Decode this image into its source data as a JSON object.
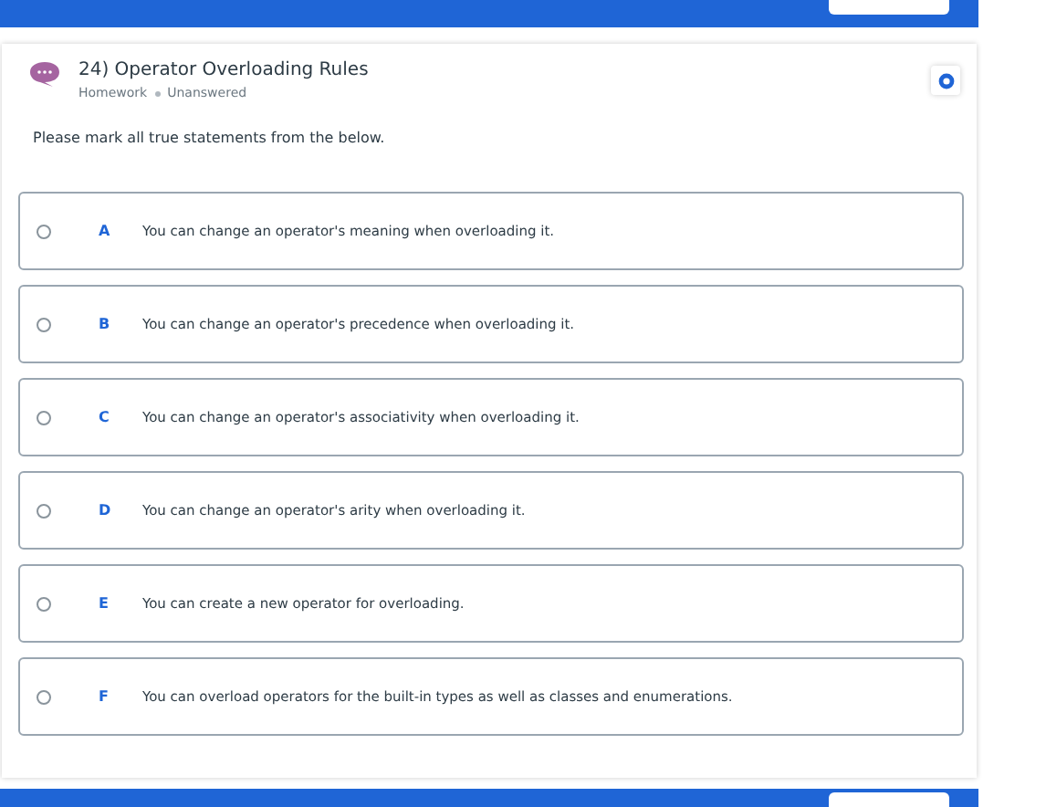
{
  "question": {
    "title": "24) Operator Overloading Rules",
    "type": "Homework",
    "status": "Unanswered",
    "prompt": "Please mark all true statements from the below."
  },
  "options": [
    {
      "letter": "A",
      "text": "You can change an operator's meaning when overloading it.",
      "selected": false
    },
    {
      "letter": "B",
      "text": "You can change an operator's precedence when overloading it.",
      "selected": false
    },
    {
      "letter": "C",
      "text": "You can change an operator's associativity when overloading it.",
      "selected": false
    },
    {
      "letter": "D",
      "text": "You can change an operator's arity when overloading it.",
      "selected": false
    },
    {
      "letter": "E",
      "text": "You can create a new operator for overloading.",
      "selected": false
    },
    {
      "letter": "F",
      "text": "You can overload operators for the built-in types as well as classes and enumerations.",
      "selected": false
    }
  ]
}
